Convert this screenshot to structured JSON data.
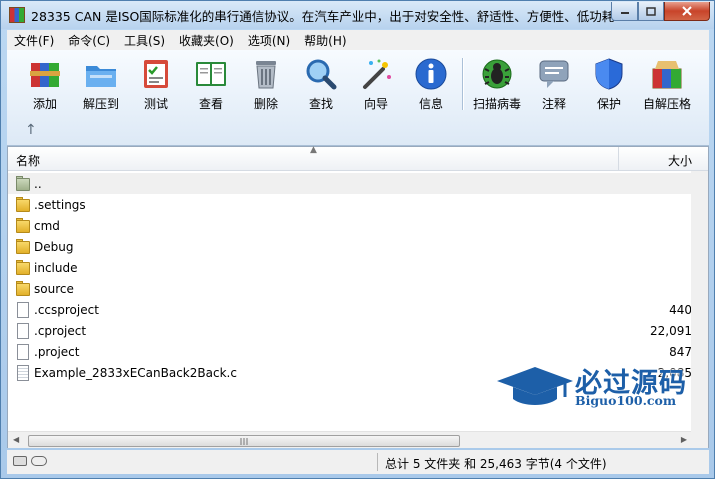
{
  "window": {
    "title": "28335 CAN 是ISO国际标准化的串行通信协议。在汽车产业中，出于对安全性、舒适性、方便性、低功耗..."
  },
  "menu": [
    "文件(F)",
    "命令(C)",
    "工具(S)",
    "收藏夹(O)",
    "选项(N)",
    "帮助(H)"
  ],
  "toolbar": {
    "buttons": [
      {
        "label": "添加",
        "icon": "add-archive-icon"
      },
      {
        "label": "解压到",
        "icon": "extract-folder-icon"
      },
      {
        "label": "测试",
        "icon": "test-checklist-icon"
      },
      {
        "label": "查看",
        "icon": "view-book-icon"
      },
      {
        "label": "删除",
        "icon": "trash-icon"
      },
      {
        "label": "查找",
        "icon": "magnifier-icon"
      },
      {
        "label": "向导",
        "icon": "wizard-wand-icon"
      },
      {
        "label": "信息",
        "icon": "info-icon"
      },
      {
        "label": "扫描病毒",
        "icon": "virus-scan-icon"
      },
      {
        "label": "注释",
        "icon": "comment-icon"
      },
      {
        "label": "保护",
        "icon": "shield-icon"
      },
      {
        "label": "自解压格",
        "icon": "sfx-box-icon"
      }
    ],
    "up_arrow": "↑"
  },
  "list": {
    "columns": {
      "name": "名称",
      "size": "大小"
    },
    "rows": [
      {
        "name": "..",
        "size": "",
        "type": "up"
      },
      {
        "name": ".settings",
        "size": "",
        "type": "folder"
      },
      {
        "name": "cmd",
        "size": "",
        "type": "folder"
      },
      {
        "name": "Debug",
        "size": "",
        "type": "folder"
      },
      {
        "name": "include",
        "size": "",
        "type": "folder"
      },
      {
        "name": "source",
        "size": "",
        "type": "folder"
      },
      {
        "name": ".ccsproject",
        "size": "440",
        "type": "file"
      },
      {
        "name": ".cproject",
        "size": "22,091",
        "type": "file"
      },
      {
        "name": ".project",
        "size": "847",
        "type": "file"
      },
      {
        "name": "Example_2833xECanBack2Back.c",
        "size": "2,085",
        "type": "cfile"
      }
    ]
  },
  "status": {
    "text": "总计 5 文件夹 和 25,463 字节(4 个文件)"
  },
  "watermark": {
    "title": "必过源码",
    "url": "Biguo100.com"
  },
  "colors": {
    "accent": "#1d5fa8",
    "window_frame": "#b7d2ee",
    "close": "#c8442a"
  }
}
